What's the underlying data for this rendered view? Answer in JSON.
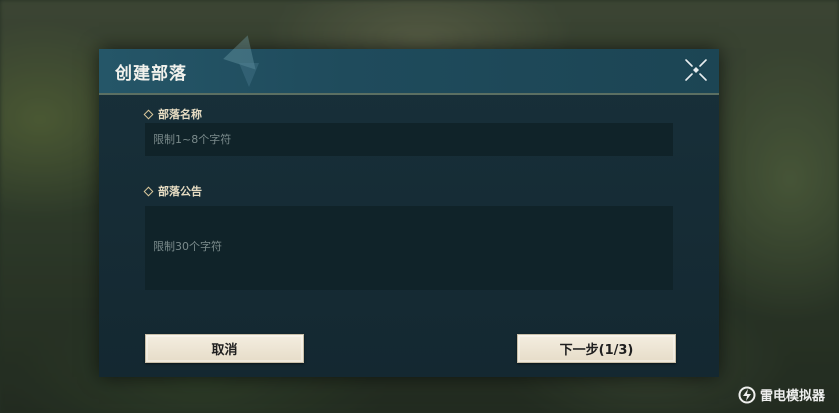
{
  "dialog": {
    "title": "创建部落",
    "close_icon": "close-x-icon"
  },
  "form": {
    "name_label": "部落名称",
    "name_placeholder": "限制1~8个字符",
    "notice_label": "部落公告",
    "notice_placeholder": "限制30个字符"
  },
  "buttons": {
    "cancel_label": "取消",
    "next_label": "下一步(1/3)"
  },
  "watermark": {
    "text": "雷电模拟器",
    "icon": "leidian-logo-icon"
  },
  "colors": {
    "title_bar": "#255668",
    "dialog_bg": "#142831",
    "label_text": "#e6dcc2",
    "button_bg": "#f4eee0"
  }
}
